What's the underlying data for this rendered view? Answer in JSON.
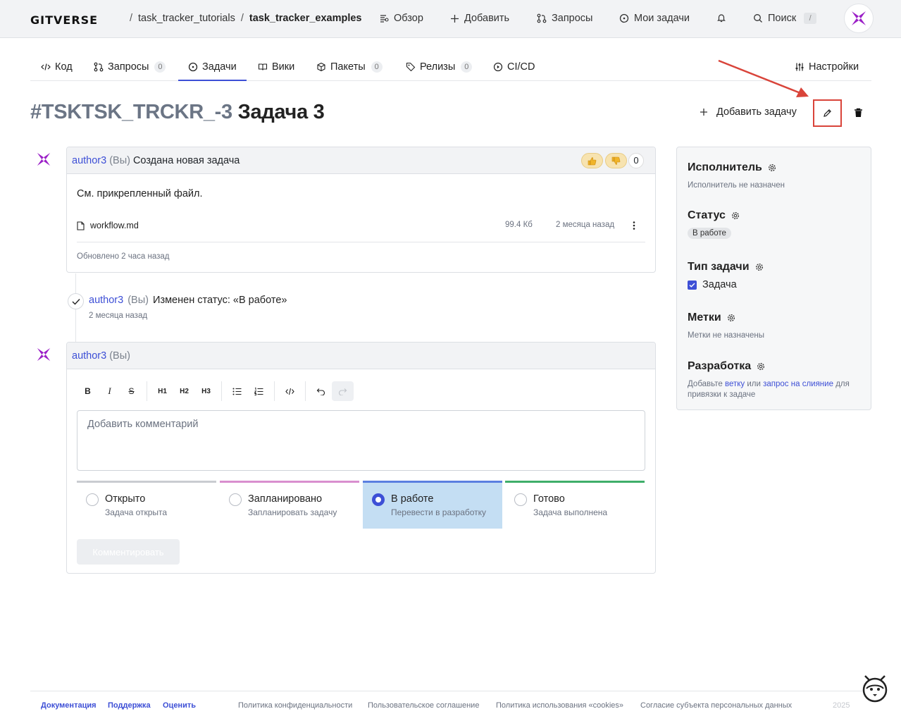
{
  "topbar": {
    "logo": "GITVERSE",
    "breadcrumb": [
      "task_tracker_tutorials",
      "task_tracker_examples"
    ],
    "sep": "/",
    "nav": {
      "overview": "Обзор",
      "add": "Добавить",
      "requests": "Запросы",
      "my_tasks": "Мои задачи",
      "search": "Поиск",
      "search_key": "/"
    }
  },
  "tabs": [
    {
      "label": "Код",
      "count": null
    },
    {
      "label": "Запросы",
      "count": "0"
    },
    {
      "label": "Задачи",
      "count": null,
      "active": true
    },
    {
      "label": "Вики",
      "count": null
    },
    {
      "label": "Пакеты",
      "count": "0"
    },
    {
      "label": "Релизы",
      "count": "0"
    },
    {
      "label": "CI/CD",
      "count": null
    }
  ],
  "settings_tab": "Настройки",
  "issue": {
    "number": "#TSKTSK_TRCKR_-3",
    "title": "Задача 3",
    "add_task": "Добавить задачу"
  },
  "first_comment": {
    "author": "author3",
    "you": "(Вы)",
    "action": "Создана новая задача",
    "reaction_count": "0",
    "body": "См. прикрепленный файл.",
    "file": {
      "name": "workflow.md",
      "size": "99.4 Кб",
      "date": "2 месяца назад"
    },
    "updated": "Обновлено 2 часа назад"
  },
  "event": {
    "author": "author3",
    "you": "(Вы)",
    "text": "Изменен статус: «В работе»",
    "date": "2 месяца назад"
  },
  "editor": {
    "author": "author3",
    "you": "(Вы)",
    "placeholder": "Добавить комментарий",
    "toolbar": {
      "bold": "B",
      "italic": "I",
      "strike": "S",
      "h1": "H1",
      "h2": "H2",
      "h3": "H3"
    },
    "statuses": [
      {
        "label": "Открыто",
        "sub": "Задача открыта",
        "color": "#c9ccd1"
      },
      {
        "label": "Запланировано",
        "sub": "Запланировать задачу",
        "color": "#d98fcf"
      },
      {
        "label": "В работе",
        "sub": "Перевести в разработку",
        "color": "#5b7fe0",
        "selected": true
      },
      {
        "label": "Готово",
        "sub": "Задача выполнена",
        "color": "#3fae6a"
      }
    ],
    "submit": "Комментировать"
  },
  "sidebar": {
    "assignee": {
      "title": "Исполнитель",
      "value": "Исполнитель не назначен"
    },
    "status": {
      "title": "Статус",
      "value": "В работе"
    },
    "type": {
      "title": "Тип задачи",
      "value": "Задача"
    },
    "labels": {
      "title": "Метки",
      "value": "Метки не назначены"
    },
    "dev": {
      "title": "Разработка",
      "pre": "Добавьте",
      "link1": "ветку",
      "mid": "или",
      "link2": "запрос на слияние",
      "post": "для привязки к задаче"
    }
  },
  "footer": {
    "links": [
      "Документация",
      "Поддержка",
      "Оценить"
    ],
    "legal": [
      "Политика конфиденциальности",
      "Пользовательское соглашение",
      "Политика использования «cookies»",
      "Согласие субъекта персональных данных"
    ],
    "year": "2025"
  },
  "colors": {
    "accent": "#3d4fd6",
    "brand": "#9b1fc7",
    "highlight": "#d9443a"
  }
}
